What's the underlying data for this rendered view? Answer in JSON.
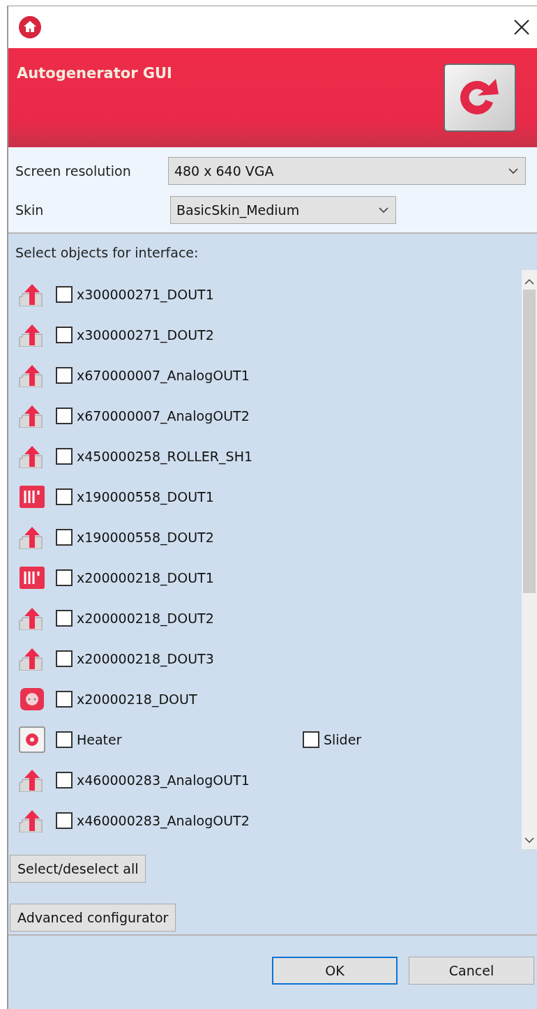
{
  "window": {
    "title": "Autogenerator GUI"
  },
  "fields": [
    {
      "label": "Screen resolution",
      "value": "480 x 640 VGA",
      "kind": "wide"
    },
    {
      "label": "Skin",
      "value": "BasicSkin_Medium",
      "kind": "narrow"
    }
  ],
  "list_label": "Select objects for interface:",
  "objects": [
    {
      "kind": "output",
      "label": "x300000271_DOUT1",
      "checked": false
    },
    {
      "kind": "output",
      "label": "x300000271_DOUT2",
      "checked": false
    },
    {
      "kind": "output",
      "label": "x670000007_AnalogOUT1",
      "checked": false
    },
    {
      "kind": "output",
      "label": "x670000007_AnalogOUT2",
      "checked": false
    },
    {
      "kind": "output",
      "label": "x450000258_ROLLER_SH1",
      "checked": false
    },
    {
      "kind": "blind",
      "label": "x190000558_DOUT1",
      "checked": false
    },
    {
      "kind": "output",
      "label": "x190000558_DOUT2",
      "checked": false
    },
    {
      "kind": "blind",
      "label": "x200000218_DOUT1",
      "checked": false
    },
    {
      "kind": "output",
      "label": "x200000218_DOUT2",
      "checked": false
    },
    {
      "kind": "output",
      "label": "x200000218_DOUT3",
      "checked": false
    },
    {
      "kind": "socket",
      "label": "x20000218_DOUT",
      "checked": false
    },
    {
      "kind": "heater",
      "label": "Heater",
      "checked": false,
      "option": {
        "label": "Slider",
        "checked": false
      }
    },
    {
      "kind": "output",
      "label": "x460000283_AnalogOUT1",
      "checked": false
    },
    {
      "kind": "output",
      "label": "x460000283_AnalogOUT2",
      "checked": false
    }
  ],
  "side_buttons": [
    "Select/deselect all",
    "Advanced configurator"
  ],
  "dialog_buttons": [
    {
      "label": "OK",
      "selected": true
    },
    {
      "label": "Cancel",
      "selected": false
    }
  ]
}
